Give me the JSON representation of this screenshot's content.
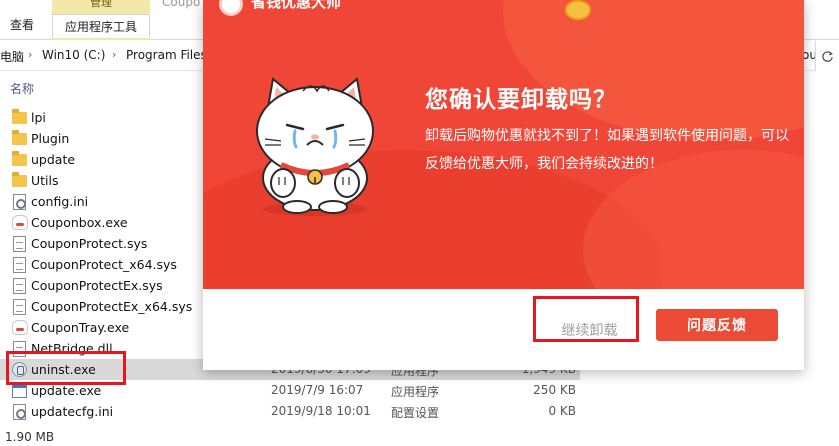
{
  "ribbon": {
    "context_group_title": "管理",
    "tabs": [
      "查看",
      "应用程序工具"
    ],
    "ghost_window_title": "Coupo"
  },
  "address_bar": {
    "crumbs": [
      "电脑",
      "Win10 (C:)",
      "Program Files"
    ],
    "overflow_text": "ou..."
  },
  "file_list": {
    "column_name_header": "名称",
    "files": [
      {
        "name": "lpi",
        "icon": "folder-icon",
        "date": "",
        "type": "",
        "size": ""
      },
      {
        "name": "Plugin",
        "icon": "folder-icon",
        "date": "",
        "type": "",
        "size": ""
      },
      {
        "name": "update",
        "icon": "folder-icon",
        "date": "",
        "type": "",
        "size": ""
      },
      {
        "name": "Utils",
        "icon": "folder-icon",
        "date": "",
        "type": "",
        "size": ""
      },
      {
        "name": "config.ini",
        "icon": "settings-file-icon",
        "date": "",
        "type": "",
        "size": ""
      },
      {
        "name": "Couponbox.exe",
        "icon": "cat-app-icon",
        "date": "",
        "type": "",
        "size": ""
      },
      {
        "name": "CouponProtect.sys",
        "icon": "system-file-icon",
        "date": "",
        "type": "",
        "size": ""
      },
      {
        "name": "CouponProtect_x64.sys",
        "icon": "system-file-icon",
        "date": "",
        "type": "",
        "size": ""
      },
      {
        "name": "CouponProtectEx.sys",
        "icon": "system-file-icon",
        "date": "",
        "type": "",
        "size": ""
      },
      {
        "name": "CouponProtectEx_x64.sys",
        "icon": "system-file-icon",
        "date": "",
        "type": "",
        "size": ""
      },
      {
        "name": "CouponTray.exe",
        "icon": "cat-app-icon",
        "date": "",
        "type": "",
        "size": ""
      },
      {
        "name": "NetBridge.dll",
        "icon": "system-file-icon",
        "date": "",
        "type": "",
        "size": ""
      },
      {
        "name": "uninst.exe",
        "icon": "uninstaller-icon",
        "date": "2019/8/30 17:09",
        "type": "应用程序",
        "size": "1,949 KB"
      },
      {
        "name": "update.exe",
        "icon": "exe-icon",
        "date": "2019/7/9 16:07",
        "type": "应用程序",
        "size": "250 KB"
      },
      {
        "name": "updatecfg.ini",
        "icon": "settings-file-icon",
        "date": "2019/9/18 10:01",
        "type": "配置设置",
        "size": "0 KB"
      }
    ]
  },
  "status_bar": {
    "text": "1.90 MB"
  },
  "dialog": {
    "logo_text": "省钱优惠大师",
    "title": "您确认要卸载吗？",
    "body": "卸载后购物优惠就找不到了！如果遇到软件使用问题，可以反馈给优惠大师，我们会持续改进的！",
    "continue_button": "继续卸载",
    "feedback_button": "问题反馈",
    "accent_color": "#f04638",
    "button_color": "#eb4a34"
  },
  "annotations": {
    "highlight_color": "#e8171f"
  }
}
